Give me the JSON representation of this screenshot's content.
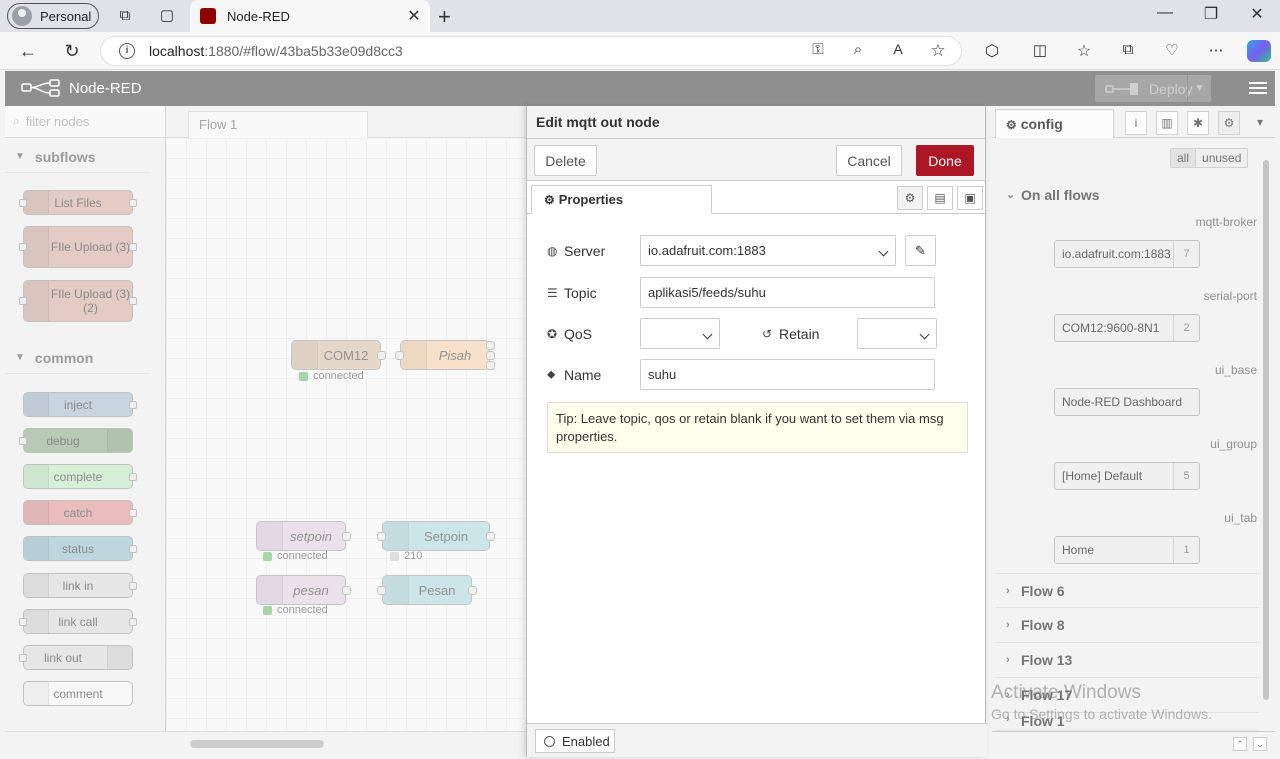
{
  "browser": {
    "profile": "Personal",
    "tab_title": "Node-RED",
    "url_host": "localhost",
    "url_path": ":1880/#flow/43ba5b33e09d8cc3"
  },
  "header": {
    "title": "Node-RED",
    "deploy_label": "Deploy"
  },
  "palette": {
    "filter_placeholder": "filter nodes",
    "categories": [
      "subflows",
      "common"
    ],
    "subflow_nodes": [
      "List Files",
      "FIle Upload (3)",
      "FIle Upload (3) (2)"
    ],
    "common_nodes": [
      "inject",
      "debug",
      "complete",
      "catch",
      "status",
      "link in",
      "link call",
      "link out",
      "comment"
    ]
  },
  "workspace": {
    "tab_label": "Flow 1",
    "nodes": {
      "com12": "COM12",
      "pisah": "Pisah",
      "setpoin_in": "setpoin",
      "setpoin_out": "Setpoin",
      "pesan_in": "pesan",
      "pesan_out": "Pesan"
    },
    "status": {
      "com12": "connected",
      "setpoin": "connected",
      "setpoin_val": "210",
      "pesan": "connected"
    }
  },
  "tray": {
    "title": "Edit mqtt out node",
    "delete_label": "Delete",
    "cancel_label": "Cancel",
    "done_label": "Done",
    "tab_properties": "Properties",
    "server_label": "Server",
    "server_value": "io.adafruit.com:1883",
    "topic_label": "Topic",
    "topic_value": "aplikasi5/feeds/suhu",
    "qos_label": "QoS",
    "retain_label": "Retain",
    "name_label": "Name",
    "name_value": "suhu",
    "tip": "Tip: Leave topic, qos or retain blank if you want to set them via msg properties.",
    "enabled_label": "Enabled"
  },
  "sidebar": {
    "tab_config": "config",
    "filter_all": "all",
    "filter_unused": "unused",
    "section_all_flows": "On all flows",
    "types": [
      "mqtt-broker",
      "serial-port",
      "ui_base",
      "ui_group",
      "ui_tab"
    ],
    "config_nodes": [
      {
        "label": "io.adafruit.com:1883",
        "count": "7"
      },
      {
        "label": "COM12:9600-8N1",
        "count": "2"
      },
      {
        "label": "Node-RED Dashboard",
        "count": ""
      },
      {
        "label": "[Home] Default",
        "count": "5"
      },
      {
        "label": "Home",
        "count": "1"
      }
    ],
    "flows": [
      "Flow 6",
      "Flow 8",
      "Flow 13",
      "Flow 17",
      "Flow 1"
    ]
  },
  "watermark": {
    "line1": "Activate Windows",
    "line2": "Go to Settings to activate Windows."
  },
  "colors": {
    "header_bg": "#8f8f8f",
    "done_bg": "#ad1625",
    "tip_bg": "#ffffed"
  }
}
